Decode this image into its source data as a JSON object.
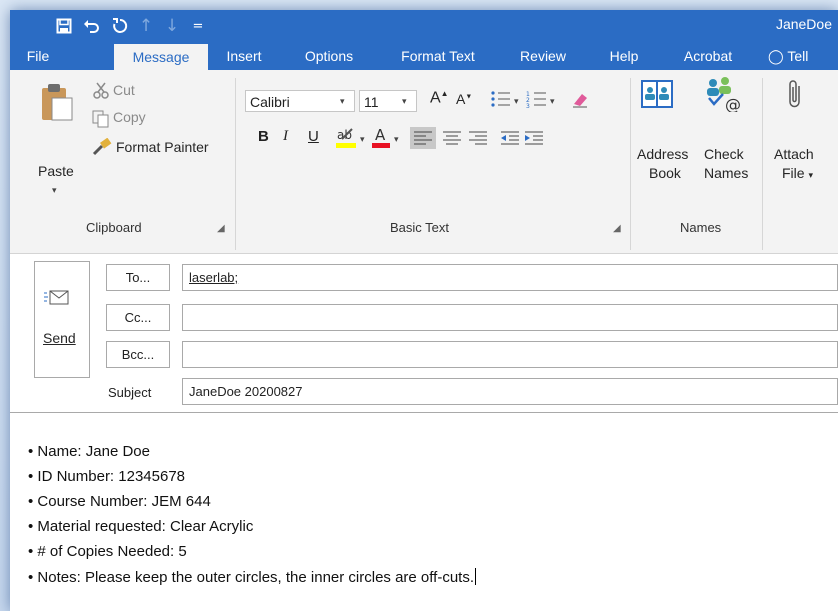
{
  "qat": {
    "save_icon": "save-icon",
    "undo_icon": "undo-icon",
    "redo_icon": "redo-icon",
    "up_icon": "arrow-up-icon",
    "down_icon": "arrow-down-icon",
    "customize_icon": "customize-qat-icon",
    "user": "JaneDoe"
  },
  "tabs": [
    "File",
    "Message",
    "Insert",
    "Options",
    "Format Text",
    "Review",
    "Help",
    "Acrobat",
    "Tell"
  ],
  "active_tab": "Message",
  "ribbon": {
    "clipboard": {
      "paste": "Paste",
      "cut": "Cut",
      "copy": "Copy",
      "format_painter": "Format Painter",
      "label": "Clipboard"
    },
    "basic_text": {
      "font": "Calibri",
      "size": "11",
      "bold": "B",
      "italic": "I",
      "underline": "U",
      "label": "Basic Text"
    },
    "names": {
      "address_book_1": "Address",
      "address_book_2": "Book",
      "check_names_1": "Check",
      "check_names_2": "Names",
      "label": "Names"
    },
    "include": {
      "attach_1": "Attach",
      "attach_2": "File"
    }
  },
  "compose": {
    "send": "Send",
    "to_button": "To...",
    "cc_button": "Cc...",
    "bcc_button": "Bcc...",
    "to_value": "laserlab;",
    "cc_value": "",
    "bcc_value": "",
    "subject_label": "Subject",
    "subject_value": "JaneDoe 20200827"
  },
  "body_lines": [
    "• Name: Jane Doe",
    "• ID Number: 12345678",
    "• Course Number: JEM 644",
    "• Material requested: Clear Acrylic",
    "• # of Copies Needed: 5",
    "• Notes: Please keep the outer circles, the inner circles are off-cuts."
  ],
  "colors": {
    "title_bar": "#2b6cc4",
    "ribbon_bg": "#f3f3f3",
    "highlight_yellow": "#ffff00",
    "font_color_red": "#e81123"
  }
}
